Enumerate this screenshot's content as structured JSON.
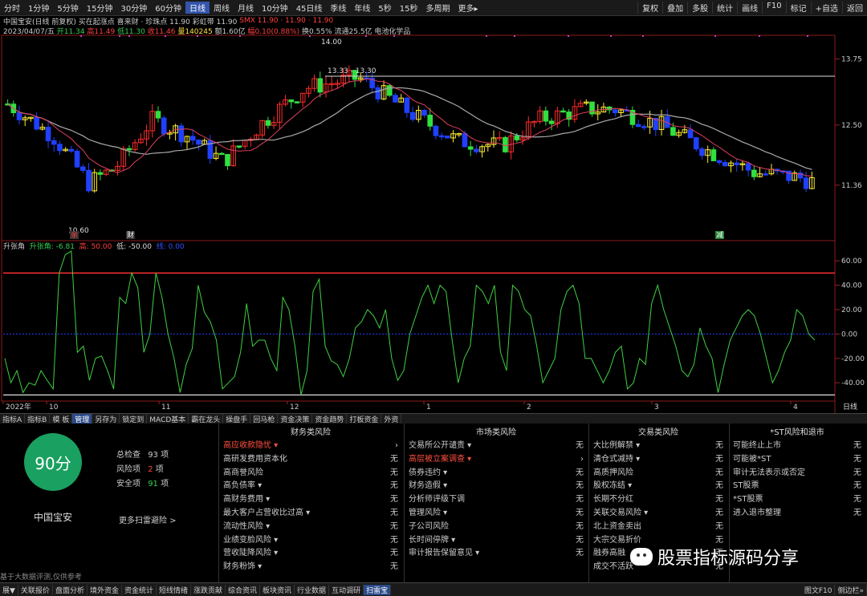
{
  "topbar": {
    "periods": [
      "分时",
      "1分钟",
      "5分钟",
      "15分钟",
      "30分钟",
      "60分钟",
      "日线",
      "周线",
      "月线",
      "10分钟",
      "45日线",
      "季线",
      "年线",
      "5秒",
      "15秒",
      "多周期",
      "更多▸"
    ],
    "active_period": "日线",
    "right_buttons": [
      "复权",
      "叠加",
      "多股",
      "统计",
      "画线",
      "F10",
      "标记",
      "+自选",
      "返回"
    ]
  },
  "info": {
    "name": "中国宝安(日线 前复权)",
    "buy_point": "买在起涨点",
    "xijiacai": "喜来财 · 珍珠点 11.90",
    "caihong": "彩虹带 11.90",
    "smx": "SMX 11.90 · 11.90 · 11.90",
    "date": "2023/04/07/五",
    "open": "开11.34",
    "high": "高11.49",
    "low": "低11.30",
    "close": "收11.46",
    "volume": "量140245",
    "amount": "额1.60亿",
    "change": "幅0.10(0.88%)",
    "turnover": "换0.55%",
    "float": "流通25.5亿",
    "industry": "电池化学品"
  },
  "price_axis": [
    "13.75",
    "12.50",
    "11.36"
  ],
  "price_labels": {
    "high": "14.00",
    "range": "13.33 - 13.30",
    "low": "10.60"
  },
  "event_marks": [
    "余",
    "财",
    "减"
  ],
  "date_axis": [
    "2022年",
    "10",
    "11",
    "12",
    "1",
    "2",
    "3",
    "4"
  ],
  "indicator": {
    "name": "升张角",
    "value_label": "升张角: -6.81",
    "high_label": "高: 50.00",
    "low_label": "低: -50.00",
    "mid_label": "线: 0.00",
    "axis": [
      "60.00",
      "40.00",
      "20.00",
      "0.00",
      "-20.00",
      "-40.00"
    ]
  },
  "corner_label": "日线",
  "tabs": [
    "指标A",
    "指标B",
    "模 板",
    "管理",
    "另存为",
    "锁定到",
    "MACD基本",
    "霸在龙头",
    "操盘手",
    "回马枪",
    "资金决策",
    "资金趋势",
    "打板资金",
    "外资"
  ],
  "active_tab": "管理",
  "scan": {
    "score": "90分",
    "stock": "中国宝安",
    "total_label": "总检查",
    "total": "93",
    "total_unit": "项",
    "risk_label": "风险项",
    "risk": "2",
    "risk_unit": "项",
    "safe_label": "安全项",
    "safe": "91",
    "safe_unit": "项",
    "more": "更多扫雷避险 >"
  },
  "columns": [
    {
      "title": "财务类风险",
      "items": [
        {
          "name": "高应收款隐忧 ▾",
          "val": "›",
          "warn": true
        },
        {
          "name": "高研发费用资本化",
          "val": "无"
        },
        {
          "name": "高商誉风险",
          "val": "无"
        },
        {
          "name": "高负债率 ▾",
          "val": "无"
        },
        {
          "name": "高财务费用 ▾",
          "val": "无"
        },
        {
          "name": "最大客户占营收比过高 ▾",
          "val": "无"
        },
        {
          "name": "流动性风险 ▾",
          "val": "无"
        },
        {
          "name": "业绩变脸风险 ▾",
          "val": "无"
        },
        {
          "name": "营收陡降风险 ▾",
          "val": "无"
        },
        {
          "name": "财务粉饰 ▾",
          "val": "无"
        }
      ]
    },
    {
      "title": "市场类风险",
      "items": [
        {
          "name": "交易所公开谴责 ▾",
          "val": "无"
        },
        {
          "name": "高层被立案调查 ▾",
          "val": "›",
          "warn": true
        },
        {
          "name": "债券违约 ▾",
          "val": "无"
        },
        {
          "name": "财务造假 ▾",
          "val": "无"
        },
        {
          "name": "分析师评级下调",
          "val": "无"
        },
        {
          "name": "管理风险 ▾",
          "val": "无"
        },
        {
          "name": "子公司风险",
          "val": "无"
        },
        {
          "name": "长时间停牌 ▾",
          "val": "无"
        },
        {
          "name": "审计报告保留意见 ▾",
          "val": "无"
        }
      ]
    },
    {
      "title": "交易类风险",
      "items": [
        {
          "name": "大比例解禁 ▾",
          "val": "无"
        },
        {
          "name": "清仓式减持 ▾",
          "val": "无"
        },
        {
          "name": "高质押风险",
          "val": "无"
        },
        {
          "name": "股权冻结 ▾",
          "val": "无"
        },
        {
          "name": "长期不分红",
          "val": "无"
        },
        {
          "name": "关联交易风险 ▾",
          "val": "无"
        },
        {
          "name": "北上资金卖出",
          "val": "无"
        },
        {
          "name": "大宗交易折价",
          "val": "无"
        },
        {
          "name": "融券高融",
          "val": "无"
        },
        {
          "name": "成交不活跃",
          "val": "无"
        }
      ]
    },
    {
      "title": "*ST风险和退市",
      "items": [
        {
          "name": "可能终止上市",
          "val": "无"
        },
        {
          "name": "可能被*ST",
          "val": "无"
        },
        {
          "name": "审计无法表示或否定",
          "val": "无"
        },
        {
          "name": "ST股票",
          "val": "无"
        },
        {
          "name": "*ST股票",
          "val": "无"
        },
        {
          "name": "进入退市整理",
          "val": "无"
        }
      ]
    }
  ],
  "disclaimer": "基于大数据评测,仅供参考",
  "watermark": "股票指标源码分享",
  "bottombar": {
    "tabs": [
      "展▼",
      "关联报价",
      "盘面分析",
      "境外资金",
      "资金统计",
      "短线情绪",
      "涨跌贡献",
      "综合资讯",
      "板块资讯",
      "行业数据",
      "互动调研",
      "扫雷宝"
    ],
    "active": "扫雷宝",
    "right": [
      "图文F10",
      "侧边栏»"
    ]
  },
  "chart_data": {
    "type": "candlestick",
    "ohlc_count": 140,
    "price_range": [
      10.4,
      14.2
    ],
    "indicator_range": [
      -55,
      70
    ],
    "high_line": 50,
    "low_line": -50,
    "mid_line": 0
  }
}
